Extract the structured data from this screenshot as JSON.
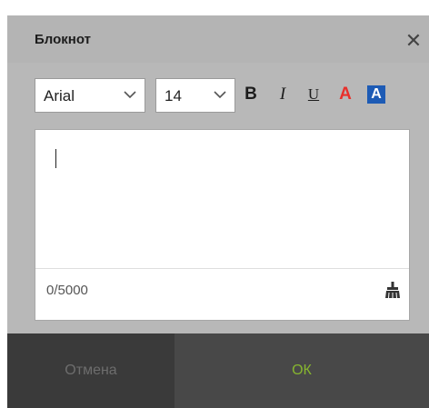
{
  "dialog": {
    "title": "Блокнот",
    "close_icon": "close-icon"
  },
  "toolbar": {
    "font_family": "Arial",
    "font_size": "14",
    "bold_label": "B",
    "italic_label": "I",
    "underline_label": "U",
    "font_color_label": "A",
    "highlight_label": "A",
    "colors": {
      "font_color": "#e8302b",
      "highlight_bg": "#1d5bb5",
      "highlight_fg": "#ffffff"
    }
  },
  "editor": {
    "value": "",
    "counter": "0/5000",
    "clear_icon": "brush-icon"
  },
  "buttons": {
    "cancel_label": "Отмена",
    "ok_label": "ОК",
    "colors": {
      "ok_text": "#86b52f",
      "cancel_text": "#6d6d6d"
    }
  }
}
